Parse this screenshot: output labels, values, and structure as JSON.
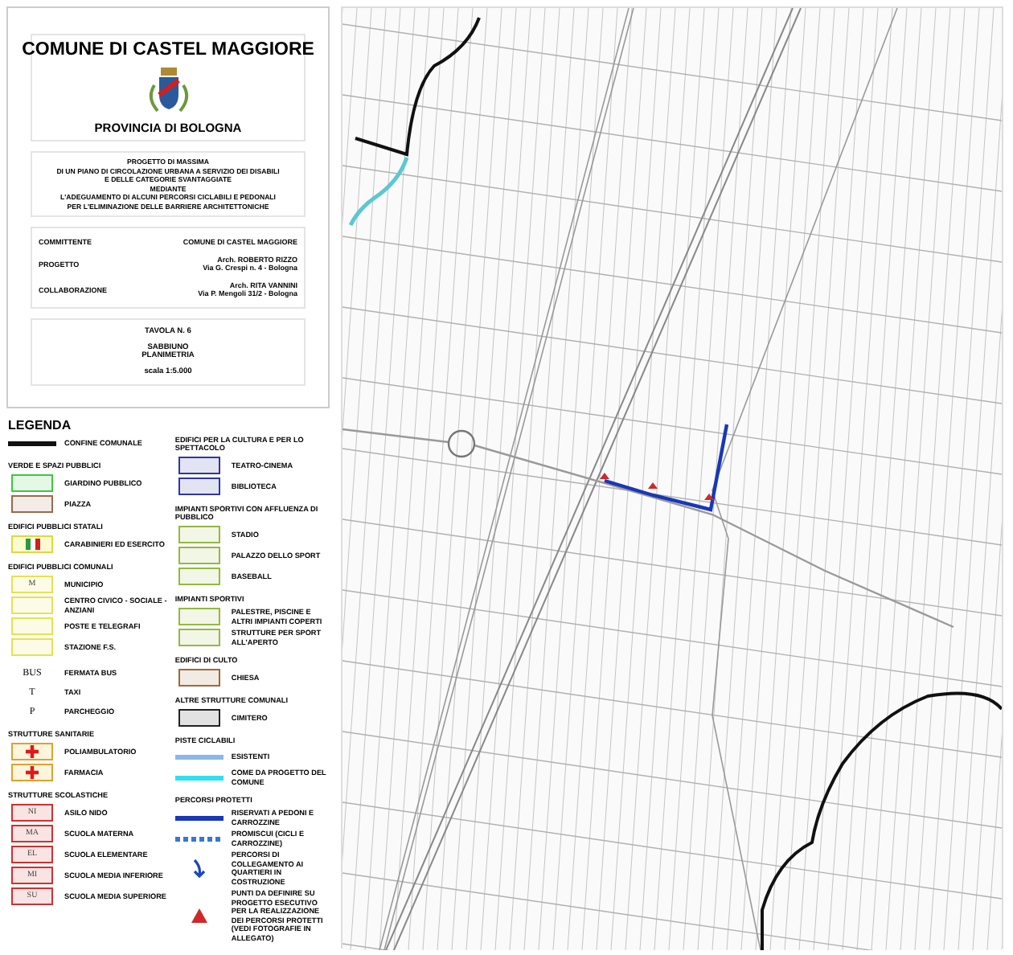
{
  "title_block": {
    "municipality": "COMUNE DI CASTEL MAGGIORE",
    "province": "PROVINCIA DI BOLOGNA",
    "project_lines": [
      "PROGETTO DI MASSIMA",
      "DI UN PIANO DI CIRCOLAZIONE URBANA A SERVIZIO DEI DISABILI",
      "E DELLE CATEGORIE SVANTAGGIATE",
      "MEDIANTE",
      "L'ADEGUAMENTO DI ALCUNI PERCORSI CICLABILI E PEDONALI",
      "PER L'ELIMINAZIONE DELLE BARRIERE ARCHITETTONICHE"
    ],
    "credits": [
      {
        "role": "COMMITTENTE",
        "lines": [
          "COMUNE DI CASTEL MAGGIORE"
        ]
      },
      {
        "role": "PROGETTO",
        "lines": [
          "Arch.  ROBERTO RIZZO",
          "Via  G. Crespi n. 4  -  Bologna"
        ]
      },
      {
        "role": "COLLABORAZIONE",
        "lines": [
          "Arch. RITA VANNINI",
          "Via P. Mengoli 31/2 - Bologna"
        ]
      }
    ],
    "sheet": {
      "number": "TAVOLA N. 6",
      "place": "SABBIUNO",
      "type": "PLANIMETRIA",
      "scale": "scala  1:5.000"
    }
  },
  "legend": {
    "title": "LEGENDA",
    "columns": [
      [
        {
          "items": [
            {
              "kind": "line",
              "color": "#111111",
              "label": "CONFINE COMUNALE"
            }
          ]
        },
        {
          "heading": "VERDE E SPAZI PUBBLICI",
          "items": [
            {
              "kind": "swatch",
              "color": "#3cc83c",
              "label": "GIARDINO PUBBLICO"
            },
            {
              "kind": "swatch",
              "color": "#9a6a4a",
              "label": "PIAZZA"
            }
          ]
        },
        {
          "heading": "EDIFICI PUBBLICI STATALI",
          "items": [
            {
              "kind": "flag",
              "color": "#e0d840",
              "label": "CARABINIERI ED ESERCITO"
            }
          ]
        },
        {
          "heading": "EDIFICI PUBBLICI COMUNALI",
          "items": [
            {
              "kind": "swatch",
              "color": "#e8e050",
              "symbol": "M",
              "label": "MUNICIPIO"
            },
            {
              "kind": "swatch",
              "color": "#e8e050",
              "label": "CENTRO CIVICO - SOCIALE - ANZIANI"
            },
            {
              "kind": "swatch",
              "color": "#e8e050",
              "label": "POSTE E TELEGRAFI"
            },
            {
              "kind": "swatch",
              "color": "#e8e050",
              "label": "STAZIONE F.S."
            }
          ]
        },
        {
          "items": [
            {
              "kind": "glyph",
              "symbol": "BUS",
              "label": "FERMATA BUS"
            },
            {
              "kind": "glyph",
              "symbol": "T",
              "label": "TAXI"
            },
            {
              "kind": "glyph",
              "symbol": "P",
              "label": "PARCHEGGIO"
            }
          ]
        },
        {
          "heading": "STRUTTURE SANITARIE",
          "items": [
            {
              "kind": "cross",
              "color": "#e0a030",
              "label": "POLIAMBULATORIO"
            },
            {
              "kind": "cross",
              "color": "#e0a030",
              "label": "FARMACIA"
            }
          ]
        },
        {
          "heading": "STRUTTURE SCOLASTICHE",
          "items": [
            {
              "kind": "swatch",
              "color": "#d03030",
              "symbol": "NI",
              "label": "ASILO NIDO"
            },
            {
              "kind": "swatch",
              "color": "#d03030",
              "symbol": "MA",
              "label": "SCUOLA MATERNA"
            },
            {
              "kind": "swatch",
              "color": "#d03030",
              "symbol": "EL",
              "label": "SCUOLA ELEMENTARE"
            },
            {
              "kind": "swatch",
              "color": "#d03030",
              "symbol": "MI",
              "label": "SCUOLA MEDIA INFERIORE"
            },
            {
              "kind": "swatch",
              "color": "#d03030",
              "symbol": "SU",
              "label": "SCUOLA MEDIA SUPERIORE"
            }
          ]
        }
      ],
      [
        {
          "heading": "EDIFICI PER LA CULTURA E PER LO SPETTACOLO",
          "items": [
            {
              "kind": "swatch",
              "color": "#3034a8",
              "label": "TEATRO-CINEMA"
            },
            {
              "kind": "swatch",
              "color": "#3034a8",
              "label": "BIBLIOTECA"
            }
          ]
        },
        {
          "heading": "IMPIANTI SPORTIVI CON AFFLUENZA DI PUBBLICO",
          "items": [
            {
              "kind": "swatch",
              "color": "#94b840",
              "label": "STADIO"
            },
            {
              "kind": "swatch",
              "color": "#94b840",
              "label": "PALAZZO DELLO SPORT"
            },
            {
              "kind": "swatch",
              "color": "#94b840",
              "label": "BASEBALL"
            }
          ]
        },
        {
          "heading": "IMPIANTI SPORTIVI",
          "items": [
            {
              "kind": "swatch",
              "color": "#94b840",
              "label": "PALESTRE, PISCINE E ALTRI IMPIANTI COPERTI"
            },
            {
              "kind": "swatch",
              "color": "#94b840",
              "label": "STRUTTURE PER SPORT ALL'APERTO"
            }
          ]
        },
        {
          "heading": "EDIFICI DI CULTO",
          "items": [
            {
              "kind": "swatch",
              "color": "#a06838",
              "label": "CHIESA"
            }
          ]
        },
        {
          "heading": "ALTRE STRUTTURE COMUNALI",
          "items": [
            {
              "kind": "swatch",
              "color": "#222222",
              "label": "CIMITERO"
            }
          ]
        },
        {
          "heading": "PISTE CICLABILI",
          "items": [
            {
              "kind": "line",
              "color": "#8ab8e8",
              "label": "ESISTENTI"
            },
            {
              "kind": "line",
              "color": "#30e0f0",
              "label": "COME DA PROGETTO DEL COMUNE"
            }
          ]
        },
        {
          "heading": "PERCORSI PROTETTI",
          "items": [
            {
              "kind": "line",
              "color": "#1838b8",
              "label": "RISERVATI A PEDONI E CARROZZINE"
            },
            {
              "kind": "dashed-line",
              "color": "#3878d0",
              "label": "PROMISCUI (CICLI E CARROZZINE)"
            },
            {
              "kind": "arrow",
              "color": "#1848c0",
              "label": "PERCORSI DI COLLEGAMENTO AI QUARTIERI IN COSTRUZIONE"
            },
            {
              "kind": "triangle",
              "color": "#d02828",
              "label": "PUNTI DA DEFINIRE SU PROGETTO ESECUTIVO PER LA REALIZZAZIONE DEI PERCORSI PROTETTI (VEDI FOTOGRAFIE IN ALLEGATO)"
            }
          ]
        }
      ]
    ]
  }
}
